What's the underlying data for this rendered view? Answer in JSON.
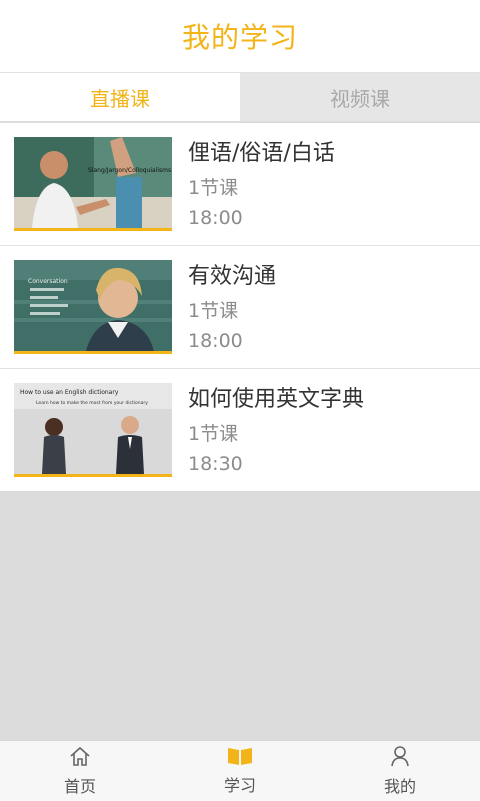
{
  "header": {
    "title": "我的学习"
  },
  "tabs": [
    {
      "label": "直播课",
      "active": true
    },
    {
      "label": "视频课",
      "active": false
    }
  ],
  "courses": [
    {
      "title": "俚语/俗语/白话",
      "lessons": "1节课",
      "time": "18:00",
      "thumb_text": [
        "Slang/Jargon/Colloquialisms"
      ]
    },
    {
      "title": "有效沟通",
      "lessons": "1节课",
      "time": "18:00",
      "thumb_text": [
        "Conversation"
      ]
    },
    {
      "title": "如何使用英文字典",
      "lessons": "1节课",
      "time": "18:30",
      "thumb_text": [
        "How to use an English dictionary",
        "Learn how to make the most from your dictionary"
      ]
    }
  ],
  "nav": [
    {
      "label": "首页",
      "icon": "home-icon",
      "active": false
    },
    {
      "label": "学习",
      "icon": "book-icon",
      "active": true
    },
    {
      "label": "我的",
      "icon": "user-icon",
      "active": false
    }
  ],
  "colors": {
    "accent": "#f2b418",
    "muted": "#8c8c8c"
  }
}
